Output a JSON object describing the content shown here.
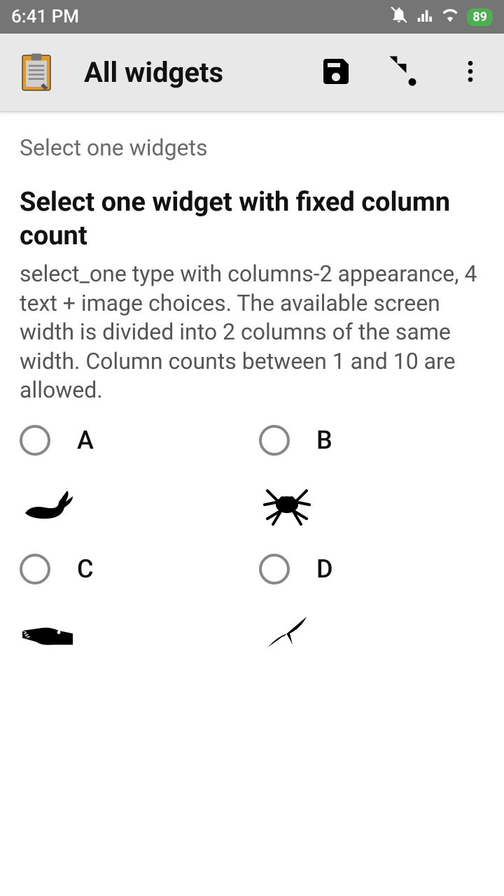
{
  "status": {
    "time": "6:41 PM",
    "battery": "89"
  },
  "appbar": {
    "title": "All widgets"
  },
  "section": {
    "label": "Select one widgets"
  },
  "question": {
    "title": "Select one widget with fixed column count",
    "hint": "select_one type with columns-2 appearance, 4 text + image choices. The available screen width is divided into 2 columns of the same width. Column counts between 1 and 10 are allowed."
  },
  "options": [
    {
      "label": "A",
      "image": "whale"
    },
    {
      "label": "B",
      "image": "frog"
    },
    {
      "label": "C",
      "image": "crocodile"
    },
    {
      "label": "D",
      "image": "bird"
    }
  ]
}
